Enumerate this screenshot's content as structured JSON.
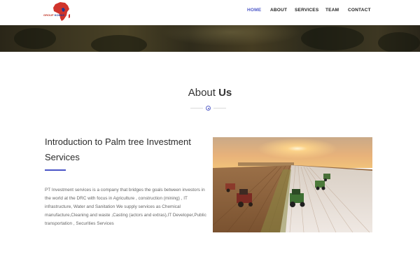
{
  "header": {
    "logo_line1": "GROUP",
    "logo_line2": "KONNS",
    "nav": [
      {
        "label": "HOME",
        "active": true
      },
      {
        "label": "ABOUT",
        "active": false
      },
      {
        "label": "SERVICES",
        "active": false
      },
      {
        "label": "TEAM",
        "active": false
      },
      {
        "label": "CONTACT",
        "active": false
      }
    ]
  },
  "about": {
    "title_light": "About",
    "title_strong": "Us"
  },
  "intro": {
    "heading": "Introduction to Palm tree Investment Services",
    "body": "PT Investment services is a company that bridges the goals between investors in the world at the DRC with focus in Agriculture , construction (mining) , IT infrastructure, Water and Sanitation We supply services as Chemical manufacture,Cleaning and waste ,Casting (actors and extras),IT Developer,Public transportation , Securities Services"
  },
  "colors": {
    "accent": "#4a55c7",
    "logo_red": "#c0392b",
    "logo_blue": "#1f3a93"
  }
}
